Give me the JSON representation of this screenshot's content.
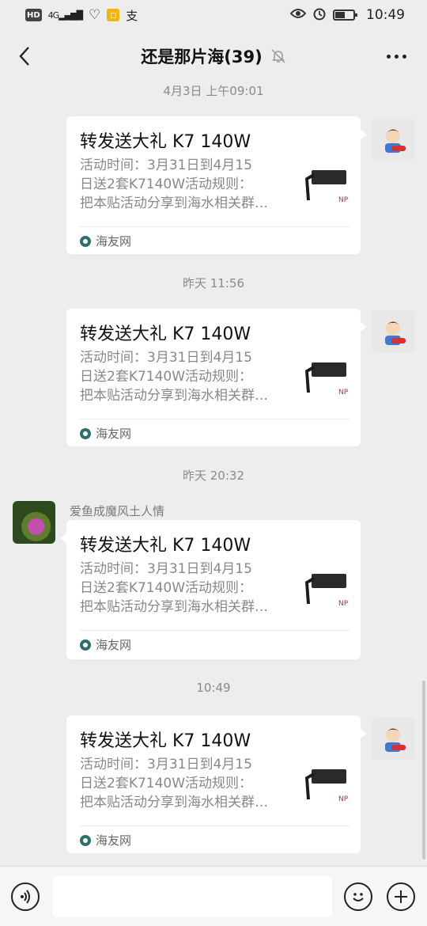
{
  "status_bar": {
    "hd": "HD",
    "network": "4G",
    "text_icon": "支",
    "time": "10:49"
  },
  "header": {
    "title": "还是那片海(39)"
  },
  "messages": [
    {
      "timestamp": "4月3日 上午09:01",
      "sender": "",
      "card": {
        "title": "转发送大礼 K7 140W",
        "lines": [
          "活动时间：3月31日到4月15",
          "日送2套K7140W活动规则：",
          "把本贴活动分享到海水相关群…"
        ],
        "source": "海友网"
      }
    },
    {
      "timestamp": "昨天 11:56",
      "sender": "",
      "card": {
        "title": "转发送大礼 K7 140W",
        "lines": [
          "活动时间：3月31日到4月15",
          "日送2套K7140W活动规则：",
          "把本贴活动分享到海水相关群…"
        ],
        "source": "海友网"
      }
    },
    {
      "timestamp": "昨天 20:32",
      "sender": "爱鱼成魔风土人情",
      "card": {
        "title": "转发送大礼 K7 140W",
        "lines": [
          "活动时间：3月31日到4月15",
          "日送2套K7140W活动规则：",
          "把本贴活动分享到海水相关群…"
        ],
        "source": "海友网"
      }
    },
    {
      "timestamp": "10:49",
      "sender": "",
      "card": {
        "title": "转发送大礼 K7 140W",
        "lines": [
          "活动时间：3月31日到4月15",
          "日送2套K7140W活动规则：",
          "把本贴活动分享到海水相关群…"
        ],
        "source": "海友网"
      }
    }
  ],
  "thumb_text": "NP",
  "input": {
    "value": ""
  },
  "colors": {
    "background": "#ededed",
    "card": "#ffffff",
    "muted_text": "#888888"
  }
}
